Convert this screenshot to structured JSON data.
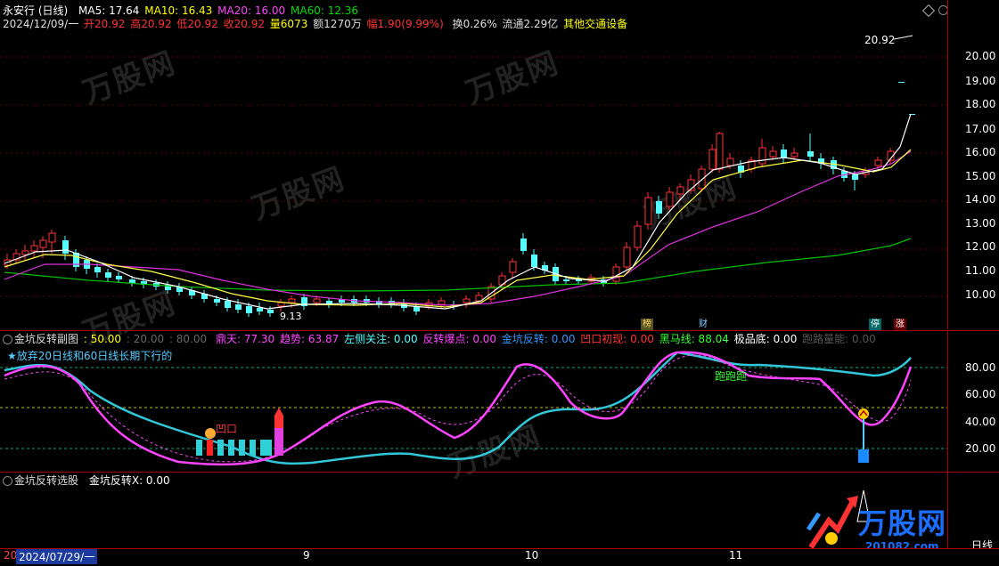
{
  "header": {
    "title": "永安行 (日线)",
    "ma5": "MA5: 17.64",
    "ma10": "MA10: 16.43",
    "ma20": "MA20: 16.00",
    "ma60": "MA60: 12.36",
    "date": "2024/12/09/一",
    "open": "开20.92",
    "high": "高20.92",
    "low": "低20.92",
    "close": "收20.92",
    "volume": "量6073",
    "amount": "额1270万",
    "change": "幅1.90(9.99%)",
    "turnover": "换0.26%",
    "float": "流通2.29亿",
    "industry": "其他交通设备",
    "price_tag": "20.92",
    "low_tag": "9.13"
  },
  "price_axis": [
    "20.00",
    "19.00",
    "18.00",
    "17.00",
    "16.00",
    "15.00",
    "14.00",
    "13.00",
    "12.00",
    "11.00",
    "10.00"
  ],
  "markers": {
    "bang": "榜",
    "cai": "财",
    "ting": "停",
    "zhang": "涨"
  },
  "indicator1": {
    "name": "金坑反转副图",
    "v1": ": 50.00",
    "v2": ": 20.00",
    "v3": ": 80.00",
    "dingtian": "鼎天: 77.30",
    "qushi": "趋势: 63.87",
    "zuoce": "左侧关注: 0.00",
    "fanzhuan": "反转爆点: 0.00",
    "jinkeng": "金坑反转: 0.00",
    "aokou": "凹口初现: 0.00",
    "heima": "黑马线: 88.04",
    "jipin": "极品底: 0.00",
    "paolu": "跑路量能: 0.00",
    "note": "★放弃20日线和60日线长期下行的",
    "label_aokou": "凹口",
    "label_pao": "跑跑跑",
    "axis": [
      "80.00",
      "60.00",
      "40.00",
      "20.00"
    ]
  },
  "indicator2": {
    "name": "金坑反转选股",
    "value": "金坑反转X: 0.00",
    "axis_label": "日线"
  },
  "bottom": {
    "start": "2024/07/29/一",
    "months": [
      "9",
      "10",
      "11"
    ],
    "prefix": "20"
  },
  "watermark": {
    "brand": "万股网",
    "site": "201082.com"
  },
  "colors": {
    "up": "#ff3333",
    "down": "#54ffff",
    "ma5": "#ffffff",
    "ma10": "#ffff00",
    "ma20": "#ff44ff",
    "ma60": "#00d000"
  }
}
